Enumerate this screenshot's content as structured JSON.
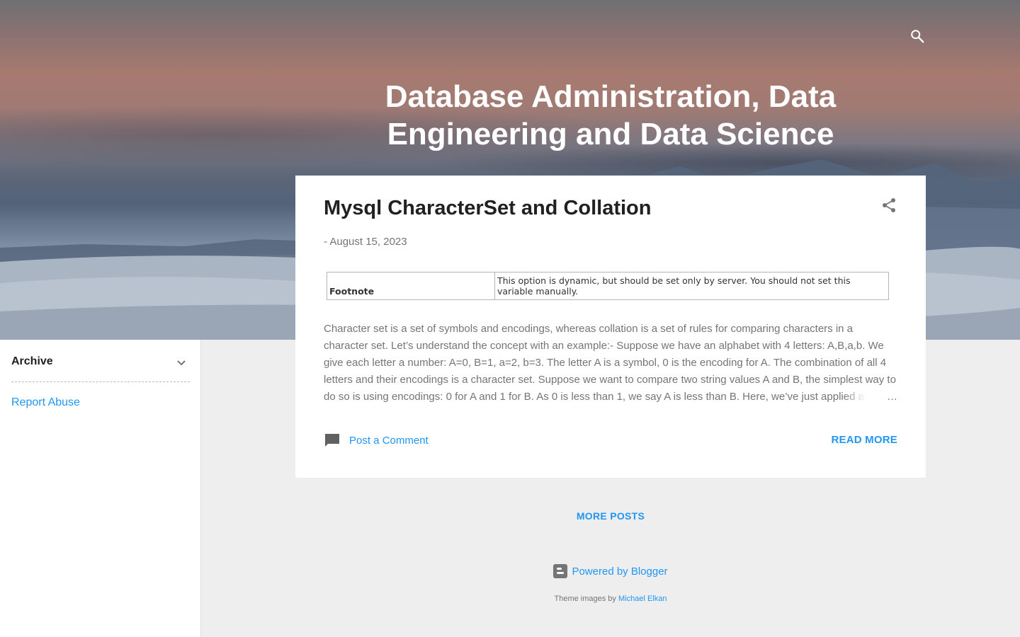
{
  "header": {
    "blog_title": "Database Administration, Data Engineering and Data Science",
    "search_icon": "search-icon"
  },
  "sidebar": {
    "archive_label": "Archive",
    "archive_icon": "chevron-down-icon",
    "report_abuse": "Report Abuse"
  },
  "post": {
    "title": "Mysql CharacterSet and Collation",
    "date_prefix": "-",
    "date": "August 15, 2023",
    "share_icon": "share-icon",
    "footnote_table": {
      "label": "Footnote",
      "text": "This option is dynamic, but should be set only by server. You should not set this variable manually."
    },
    "snippet": "Character set is a set of symbols and encodings, whereas collation is a set of rules for comparing characters in a character set. Let’s understand the concept with an example:- Suppose we have an alphabet with 4 letters: A,B,a,b. We give each letter a number: A=0, B=1, a=2, b=3. The letter A is a symbol, 0 is the encoding for A. The combination of all 4 letters and their encodings is a character set. Suppose we want to compare two string values A and B, the simplest way to do so is using encodings: 0 for A and 1 for B. As 0 is less than 1, we say A is less than B. Here, we’ve just applied a",
    "ellipsis": "…",
    "comment_label": "Post a Comment",
    "comment_icon": "comment-icon",
    "read_more": "READ MORE"
  },
  "footer": {
    "more_posts": "MORE POSTS",
    "powered_by": "Powered by Blogger",
    "blogger_icon": "blogger-icon",
    "theme_images_prefix": "Theme images by",
    "theme_images_author": "Michael Elkan"
  },
  "colors": {
    "accent": "#2196f3",
    "background": "#eeeeee",
    "card": "#ffffff",
    "muted_text": "#757575"
  }
}
